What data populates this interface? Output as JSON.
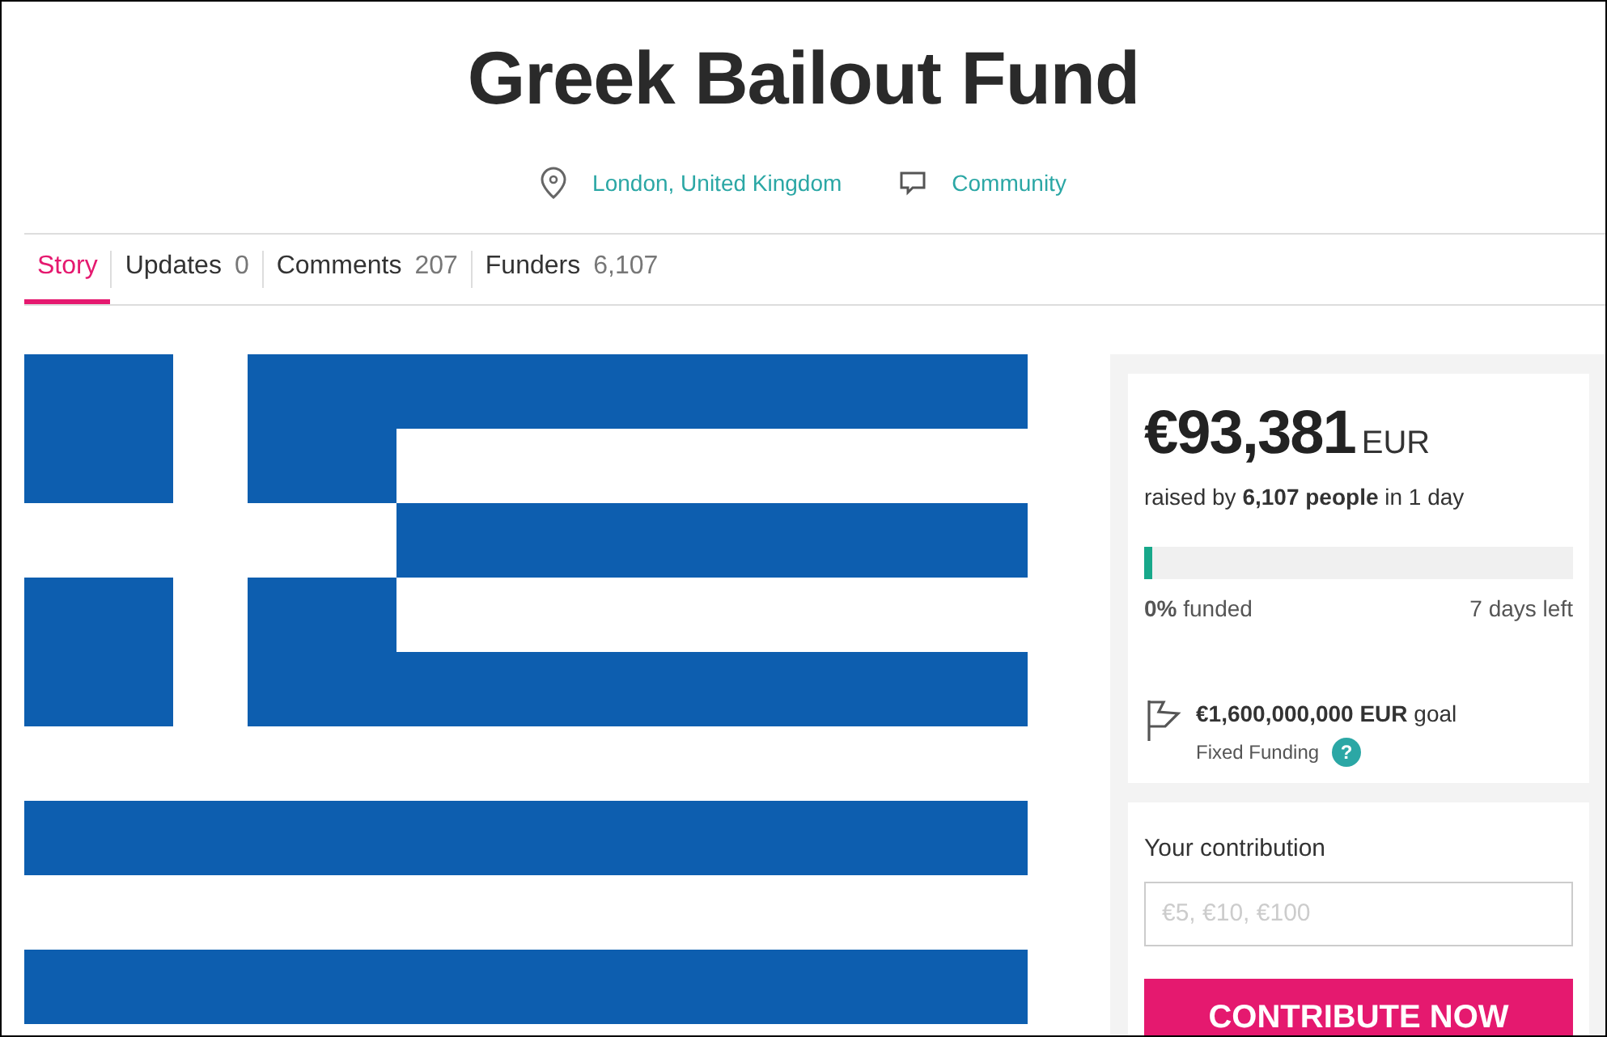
{
  "title": "Greek Bailout Fund",
  "meta": [
    {
      "kind": "location",
      "label": "London, United Kingdom"
    },
    {
      "kind": "category",
      "label": "Community"
    }
  ],
  "tabs": [
    {
      "label": "Story",
      "selected": true
    },
    {
      "label": "Updates",
      "count": "0",
      "selected": false
    },
    {
      "label": "Comments",
      "count": "207",
      "selected": false
    },
    {
      "label": "Funders",
      "count": "6,107",
      "selected": false
    }
  ],
  "funding": {
    "amount": "€93,381",
    "currency": "EUR",
    "raised": "raised by **6,107 people** in 1 day",
    "level": 0.02,
    "funded": "**0%** funded",
    "days_left": "7 days left",
    "goal": "**€1,600,000,000 EUR** goal",
    "funding_type": "Fixed Funding",
    "help": "?"
  },
  "contribution": {
    "label": "Your contribution",
    "placeholder": "€5, €10, €100",
    "button": "CONTRIBUTE NOW"
  }
}
